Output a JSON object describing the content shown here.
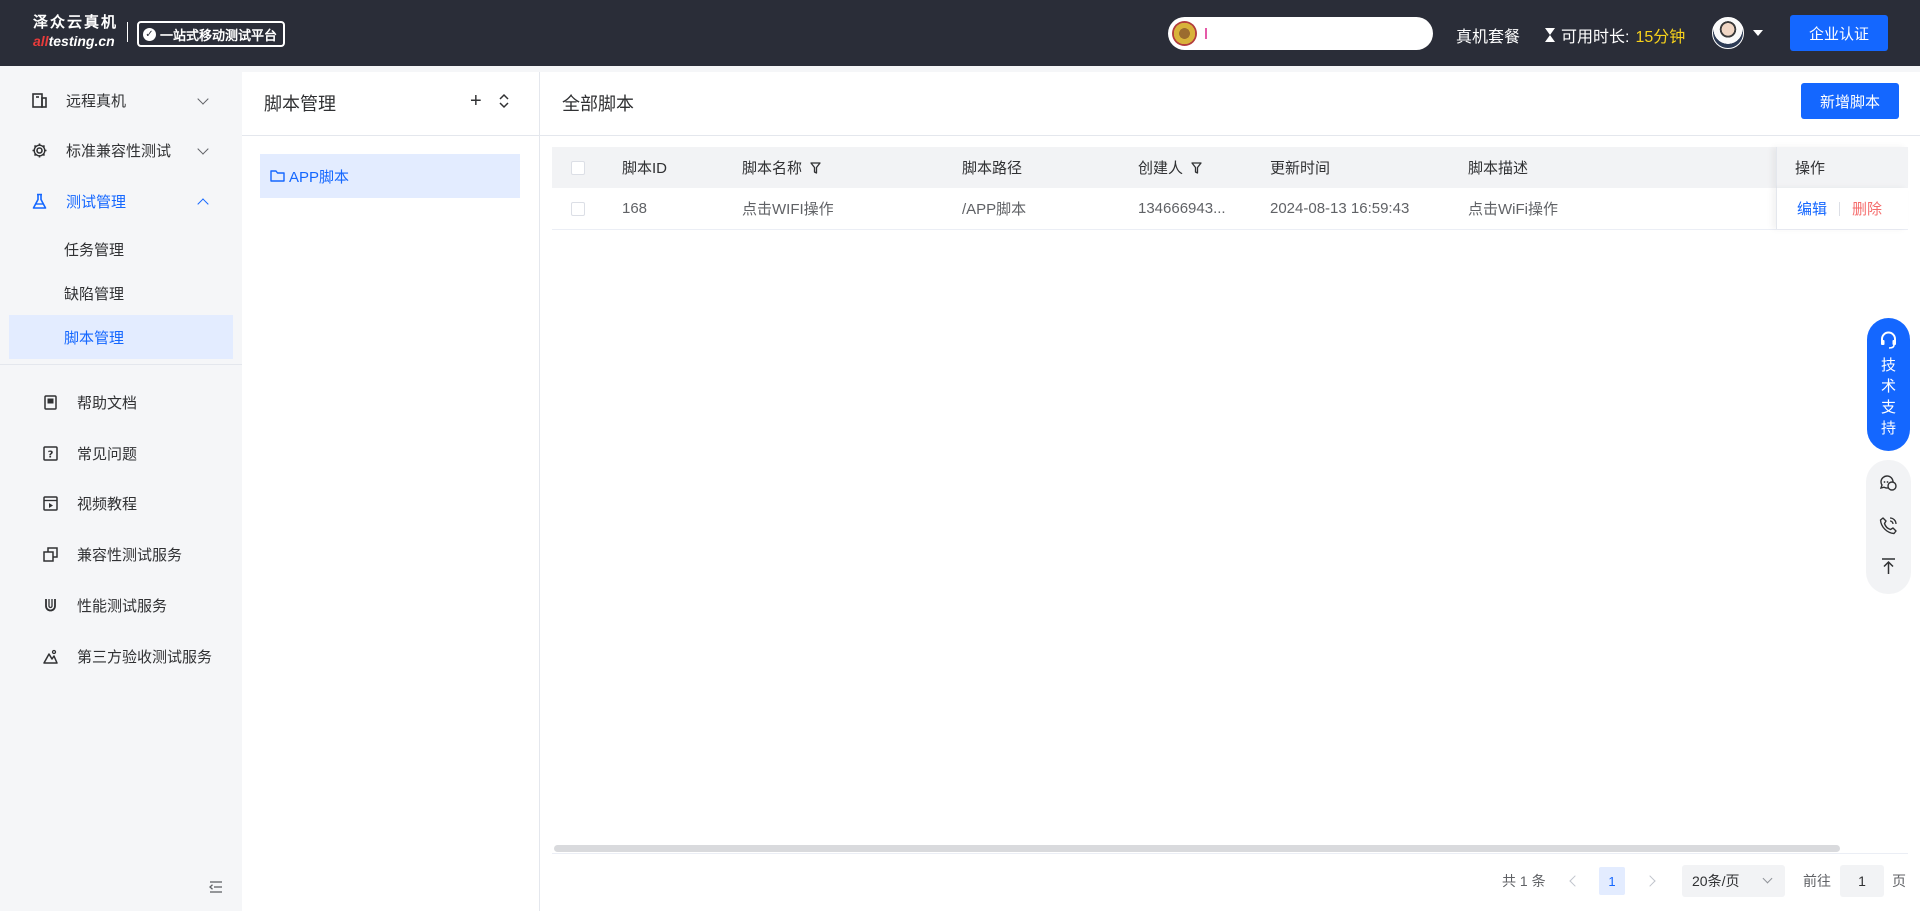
{
  "header": {
    "logo_line1": "泽众云真机",
    "logo_line2_red": "all",
    "logo_line2_rest": "testing.cn",
    "slogan": "一站式移动测试平台",
    "package_link": "真机套餐",
    "time_label": "可用时长:",
    "time_value": "15分钟",
    "enterprise_button": "企业认证"
  },
  "sidebar": {
    "menu": [
      {
        "label": "远程真机",
        "icon": "device-icon",
        "expanded": false
      },
      {
        "label": "标准兼容性测试",
        "icon": "gear-icon",
        "expanded": false
      },
      {
        "label": "测试管理",
        "icon": "flask-icon",
        "expanded": true
      }
    ],
    "submenu": [
      "任务管理",
      "缺陷管理",
      "脚本管理"
    ],
    "help": [
      {
        "label": "帮助文档",
        "icon": "book-icon"
      },
      {
        "label": "常见问题",
        "icon": "question-icon"
      },
      {
        "label": "视频教程",
        "icon": "video-icon"
      },
      {
        "label": "兼容性测试服务",
        "icon": "copy-icon"
      },
      {
        "label": "性能测试服务",
        "icon": "magnet-icon"
      },
      {
        "label": "第三方验收测试服务",
        "icon": "mountain-icon"
      }
    ]
  },
  "tree": {
    "title": "脚本管理",
    "nodes": [
      "APP脚本"
    ]
  },
  "main": {
    "title": "全部脚本",
    "add_button": "新增脚本",
    "columns": {
      "id": "脚本ID",
      "name": "脚本名称",
      "path": "脚本路径",
      "creator": "创建人",
      "updated": "更新时间",
      "desc": "脚本描述",
      "ops": "操作"
    },
    "rows": [
      {
        "id": "168",
        "name": "点击WIFI操作",
        "path": "/APP脚本",
        "creator": "134666943...",
        "updated": "2024-08-13 16:59:43",
        "desc": "点击WiFi操作",
        "edit": "编辑",
        "delete": "删除"
      }
    ],
    "pagination": {
      "total": "共 1 条",
      "current_page": "1",
      "page_size": "20条/页",
      "goto_label": "前往",
      "goto_value": "1",
      "page_suffix": "页"
    }
  },
  "support": {
    "chars": [
      "技",
      "术",
      "支",
      "持"
    ]
  },
  "colors": {
    "primary": "#1467ff",
    "header_bg": "#2a2d38",
    "time_highlight": "#f7d21b",
    "danger": "#f56c6c"
  }
}
